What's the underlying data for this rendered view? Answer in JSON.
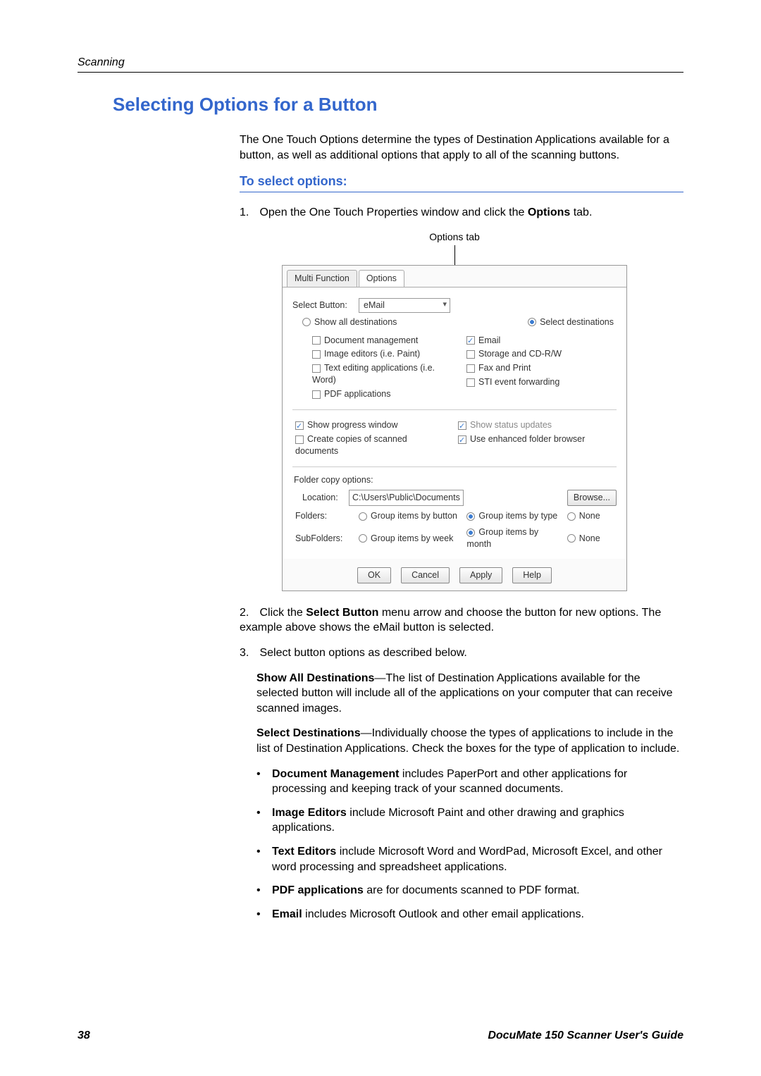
{
  "page": {
    "running_header": "Scanning",
    "footer_left": "38",
    "footer_right": "DocuMate 150 Scanner User's Guide"
  },
  "headings": {
    "section": "Selecting Options for a Button",
    "subsection": "To select options:"
  },
  "intro": "The One Touch Options determine the types of Destination Applications available for a button, as well as additional options that apply to all of the scanning buttons.",
  "steps": {
    "s1_a": "Open the One Touch Properties window and click the ",
    "s1_b": "Options",
    "s1_c": " tab.",
    "caption": "Options tab",
    "s2_a": "Click the ",
    "s2_b": "Select Button",
    "s2_c": " menu arrow and choose the button for new options. The example above shows the eMail button is selected.",
    "s3": "Select button options as described below.",
    "p_show_all_a": "Show All Destinations",
    "p_show_all_b": "—The list of Destination Applications available for the selected button will include all of the applications on your computer that can receive scanned images.",
    "p_select_a": "Select Destinations",
    "p_select_b": "—Individually choose the types of applications to include in the list of Destination Applications. Check the boxes for the type of application to include."
  },
  "bullets": {
    "b1_a": "Document Management",
    "b1_b": " includes PaperPort and other applications for processing and keeping track of your scanned documents.",
    "b2_a": "Image Editors",
    "b2_b": " include Microsoft Paint and other drawing and graphics applications.",
    "b3_a": "Text Editors",
    "b3_b": " include Microsoft Word and WordPad, Microsoft Excel, and other word processing and spreadsheet applications.",
    "b4_a": "PDF applications",
    "b4_b": " are for documents scanned to PDF format.",
    "b5_a": "Email",
    "b5_b": " includes Microsoft Outlook and other email applications."
  },
  "dialog": {
    "tab1": "Multi Function",
    "tab2": "Options",
    "select_button_label": "Select Button:",
    "select_button_value": "eMail",
    "radio_show_all": "Show all destinations",
    "radio_select_dest": "Select destinations",
    "chk_left": {
      "doc_mgmt": "Document management",
      "image_editors": "Image editors (i.e. Paint)",
      "text_editing": "Text editing applications (i.e. Word)",
      "pdf_apps": "PDF applications"
    },
    "chk_right": {
      "email": "Email",
      "storage": "Storage and CD-R/W",
      "fax": "Fax and Print",
      "sti": "STI event forwarding"
    },
    "chk_show_progress": "Show progress window",
    "chk_create_copies": "Create copies of scanned documents",
    "chk_status_updates": "Show status updates",
    "chk_enhanced_browser": "Use enhanced folder browser",
    "folder_copy_label": "Folder copy options:",
    "location_label": "Location:",
    "location_value": "C:\\Users\\Public\\Documents",
    "browse": "Browse...",
    "folders_label": "Folders:",
    "subfolders_label": "SubFolders:",
    "group_by_button": "Group items by button",
    "group_by_type": "Group items by type",
    "group_by_week": "Group items by week",
    "group_by_month": "Group items by month",
    "none": "None",
    "btn_ok": "OK",
    "btn_cancel": "Cancel",
    "btn_apply": "Apply",
    "btn_help": "Help"
  }
}
